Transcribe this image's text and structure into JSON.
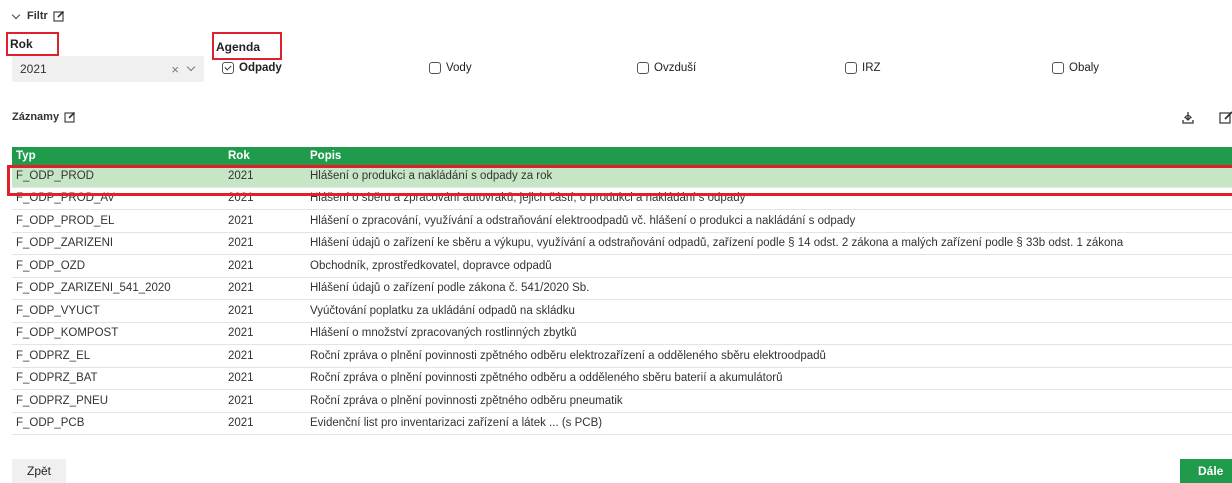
{
  "filter": {
    "title": "Filtr",
    "rok_label": "Rok",
    "agenda_label": "Agenda",
    "rok_value": "2021",
    "clear_symbol": "×",
    "checkboxes": [
      {
        "label": "Odpady",
        "checked": true
      },
      {
        "label": "Vody",
        "checked": false
      },
      {
        "label": "Ovzduší",
        "checked": false
      },
      {
        "label": "IRZ",
        "checked": false
      },
      {
        "label": "Obaly",
        "checked": false
      }
    ]
  },
  "records": {
    "title": "Záznamy",
    "columns": [
      "Typ",
      "Rok",
      "Popis"
    ],
    "rows": [
      {
        "typ": "F_ODP_PROD",
        "rok": "2021",
        "popis": "Hlášení o produkci a nakládání s odpady za rok"
      },
      {
        "typ": "F_ODP_PROD_AV",
        "rok": "2021",
        "popis": "Hlášení o sběru a zpracování autovraků, jejich částí, o produkci a nakládání s odpady"
      },
      {
        "typ": "F_ODP_PROD_EL",
        "rok": "2021",
        "popis": "Hlášení o zpracování, využívání a odstraňování elektroodpadů vč. hlášení o produkci a nakládání s odpady"
      },
      {
        "typ": "F_ODP_ZARIZENI",
        "rok": "2021",
        "popis": "Hlášení údajů o zařízení ke sběru a výkupu, využívání a odstraňování odpadů, zařízení podle § 14 odst. 2 zákona a malých zařízení podle § 33b odst. 1 zákona"
      },
      {
        "typ": "F_ODP_OZD",
        "rok": "2021",
        "popis": "Obchodník, zprostředkovatel, dopravce odpadů"
      },
      {
        "typ": "F_ODP_ZARIZENI_541_2020",
        "rok": "2021",
        "popis": "Hlášení údajů o zařízení podle zákona č. 541/2020 Sb."
      },
      {
        "typ": "F_ODP_VYUCT",
        "rok": "2021",
        "popis": "Vyúčtování poplatku za ukládání odpadů na skládku"
      },
      {
        "typ": "F_ODP_KOMPOST",
        "rok": "2021",
        "popis": "Hlášení o množství zpracovaných rostlinných zbytků"
      },
      {
        "typ": "F_ODPRZ_EL",
        "rok": "2021",
        "popis": "Roční zpráva o plnění povinnosti zpětného odběru elektrozařízení a odděleného sběru elektroodpadů"
      },
      {
        "typ": "F_ODPRZ_BAT",
        "rok": "2021",
        "popis": "Roční zpráva o plnění povinnosti zpětného odběru a odděleného sběru baterií a akumulátorů"
      },
      {
        "typ": "F_ODPRZ_PNEU",
        "rok": "2021",
        "popis": "Roční zpráva o plnění povinnosti zpětného odběru pneumatik"
      },
      {
        "typ": "F_ODP_PCB",
        "rok": "2021",
        "popis": "Evidenční list pro inventarizaci zařízení a látek ... (s PCB)"
      }
    ],
    "selected_index": 0
  },
  "footer": {
    "back_label": "Zpět",
    "next_label": "Dále"
  },
  "colors": {
    "accent": "#1f9b4b",
    "selected_row": "#c7e6c6",
    "highlight_outline": "#e0202a"
  },
  "icons": [
    "chevron-down-icon",
    "edit-icon",
    "clear-icon",
    "download-icon"
  ]
}
